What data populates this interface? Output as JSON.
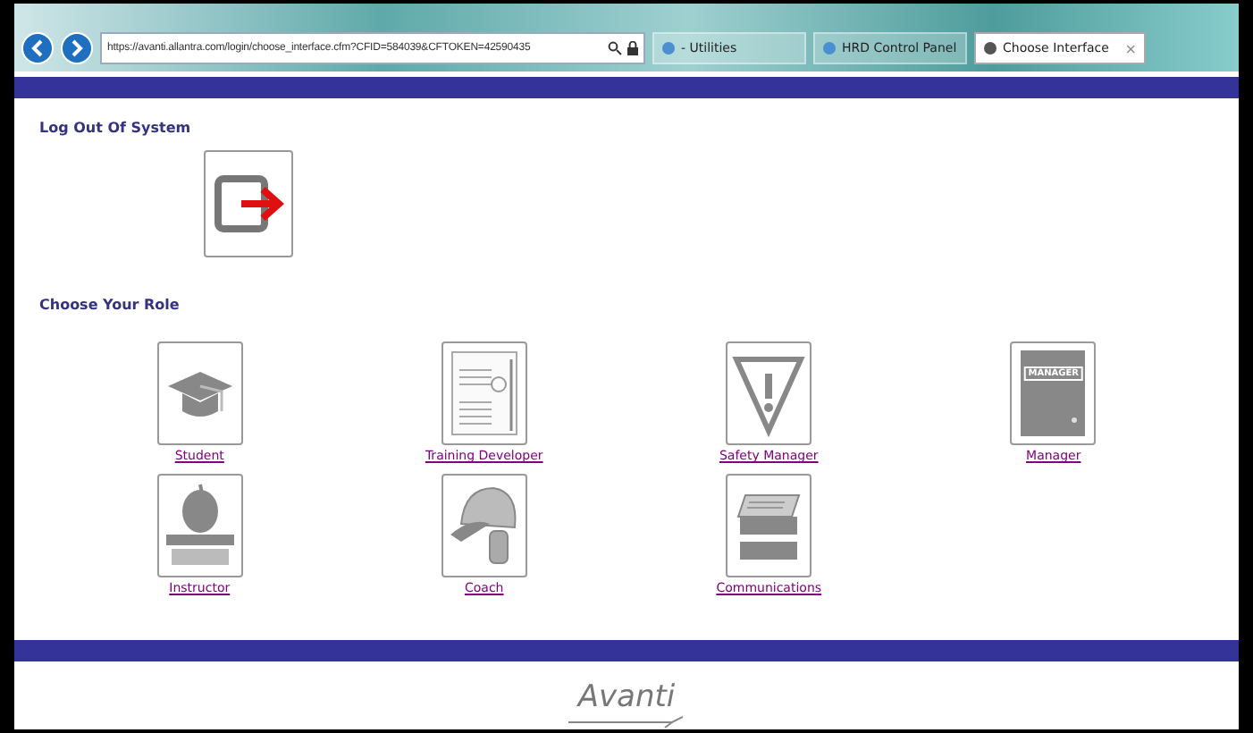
{
  "browser": {
    "address": "https://avanti.allantra.com/login/choose_interface.cfm?CFID=584039&CFTOKEN=42590435",
    "tabs": [
      {
        "label": "- Utilities",
        "selected": false
      },
      {
        "label": "HRD Control Panel",
        "selected": false
      },
      {
        "label": "Choose Interface",
        "selected": true,
        "close": "×"
      }
    ]
  },
  "logout": {
    "heading": "Log Out Of System"
  },
  "roles": {
    "heading": "Choose Your Role",
    "items": [
      {
        "kind": "student",
        "label": "Student"
      },
      {
        "kind": "developer",
        "label": "Training Developer"
      },
      {
        "kind": "safety",
        "label": "Safety Manager"
      },
      {
        "kind": "manager",
        "label": "Manager",
        "icon_text": "MANAGER"
      },
      {
        "kind": "instructor",
        "label": "Instructor"
      },
      {
        "kind": "coach",
        "label": "Coach"
      },
      {
        "kind": "communications",
        "label": "Communications"
      }
    ]
  },
  "footer": {
    "logo": "Avanti"
  }
}
